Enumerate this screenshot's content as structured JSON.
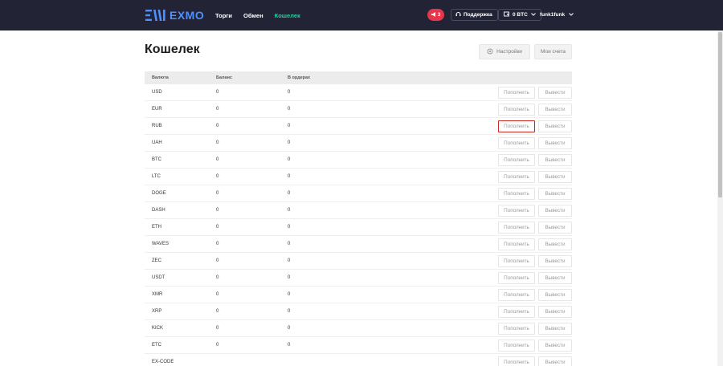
{
  "header": {
    "logo_text": "EXMO",
    "nav": [
      {
        "label": "Торги",
        "active": false
      },
      {
        "label": "Обмен",
        "active": false
      },
      {
        "label": "Кошелек",
        "active": true
      }
    ],
    "notifications_count": "3",
    "support_label": "Поддержка",
    "balance_label": "0 BTC",
    "username": "funk1funk"
  },
  "page": {
    "title": "Кошелек",
    "settings_label": "Настройки",
    "accounts_label": "Мои счета"
  },
  "table": {
    "headers": {
      "currency": "Валюта",
      "balance": "Баланс",
      "in_orders": "В ордерах"
    },
    "deposit_label": "Пополнить",
    "withdraw_label": "Вывести",
    "rows": [
      {
        "currency": "USD",
        "balance": "0",
        "in_orders": "0"
      },
      {
        "currency": "EUR",
        "balance": "0",
        "in_orders": "0"
      },
      {
        "currency": "RUB",
        "balance": "0",
        "in_orders": "0"
      },
      {
        "currency": "UAH",
        "balance": "0",
        "in_orders": "0"
      },
      {
        "currency": "BTC",
        "balance": "0",
        "in_orders": "0"
      },
      {
        "currency": "LTC",
        "balance": "0",
        "in_orders": "0"
      },
      {
        "currency": "DOGE",
        "balance": "0",
        "in_orders": "0"
      },
      {
        "currency": "DASH",
        "balance": "0",
        "in_orders": "0"
      },
      {
        "currency": "ETH",
        "balance": "0",
        "in_orders": "0"
      },
      {
        "currency": "WAVES",
        "balance": "0",
        "in_orders": "0"
      },
      {
        "currency": "ZEC",
        "balance": "0",
        "in_orders": "0"
      },
      {
        "currency": "USDT",
        "balance": "0",
        "in_orders": "0"
      },
      {
        "currency": "XMR",
        "balance": "0",
        "in_orders": "0"
      },
      {
        "currency": "XRP",
        "balance": "0",
        "in_orders": "0"
      },
      {
        "currency": "KICK",
        "balance": "0",
        "in_orders": "0"
      },
      {
        "currency": "ETC",
        "balance": "0",
        "in_orders": "0"
      },
      {
        "currency": "EX-CODE",
        "balance": "",
        "in_orders": ""
      }
    ]
  },
  "colors": {
    "header_bg": "#232336",
    "active_nav": "#26d3a0",
    "logo_blue": "#4f8fff",
    "notif_red": "#e5364b",
    "highlight_border": "#c8281e"
  }
}
